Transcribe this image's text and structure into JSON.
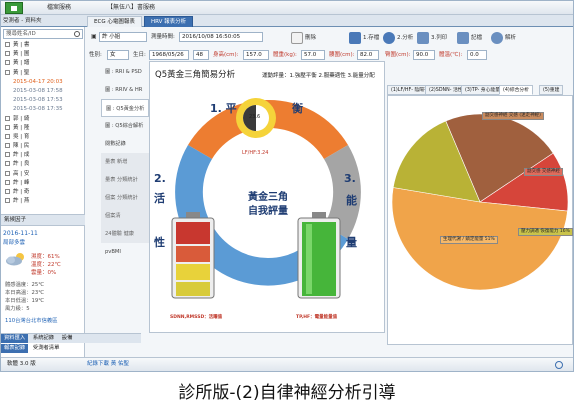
{
  "topbar": {
    "buttons": [
      "檔案服務",
      "【無伍八】書服務"
    ]
  },
  "tabs": [
    "ECG 心電圖報表",
    "HRV 報表分析"
  ],
  "left": {
    "search_placeholder": "搜尋姓名/ID",
    "title": "受測者 - 資料夾",
    "patients": [
      {
        "label": "黃 | 書",
        "type": "row"
      },
      {
        "label": "黃 | 圖",
        "type": "row"
      },
      {
        "label": "黃 | 譜",
        "type": "row"
      },
      {
        "label": "黃 | 聖",
        "type": "row"
      },
      {
        "label": "2015-04-17 20:03",
        "type": "date",
        "selected": true
      },
      {
        "label": "2015-03-08 17:58",
        "type": "date"
      },
      {
        "label": "2015-03-08 17:53",
        "type": "date"
      },
      {
        "label": "2015-03-08 17:35",
        "type": "date"
      },
      {
        "label": "郭 | 綺",
        "type": "row"
      },
      {
        "label": "黃 | 隆",
        "type": "row"
      },
      {
        "label": "吳 | 育",
        "type": "row"
      },
      {
        "label": "陳 | 民",
        "type": "row"
      },
      {
        "label": "許 | 成",
        "type": "row"
      },
      {
        "label": "許 | 良",
        "type": "row"
      },
      {
        "label": "高 | 安",
        "type": "row"
      },
      {
        "label": "許 | 峰",
        "type": "row"
      },
      {
        "label": "許 | 奇",
        "type": "row"
      },
      {
        "label": "許 | 燕",
        "type": "row"
      }
    ],
    "mini_panel_title": "氣候因子",
    "weather": {
      "date": "2016-11-11",
      "city": "局部多雲",
      "humidity_label": "濕度：",
      "humidity": "61%",
      "temp_label": "溫度：",
      "temp": "22℃",
      "cloud_label": "雲量：",
      "cloud": "0%",
      "lines": [
        "體感溫度：25℃",
        "本日高溫：23℃",
        "本日低溫：19℃",
        "     風力級：5"
      ],
      "location": "110台灣台北市信義區"
    },
    "bottom_tabs": [
      "資料匯入",
      "系統記錄",
      "設備"
    ],
    "bottom_tabs2": [
      "報表記錄",
      "受測者清單"
    ]
  },
  "status": {
    "left": "軟體 3.0 版",
    "middle": "紀錄下載  黃 佑聖"
  },
  "toolbar": {
    "name_value": "許 小姐",
    "measure_label": "測量時間:",
    "measure_value": "2016/10/08 16:50:05",
    "delete_label": "刪除",
    "save_label": "1.存檔",
    "analyze_label": "2.分析",
    "print_label": "3.列印",
    "record_label": "記檔",
    "help_label": "解析"
  },
  "infobar": {
    "sex_label": "性別:",
    "sex": "女",
    "birth_label": "生日:",
    "birth": "1968/05/26",
    "age": "48",
    "height_label": "身高(cm):",
    "height": "157.0",
    "weight_label": "體重(kg):",
    "weight": "57.0",
    "waist_label": "腰圍(cm):",
    "waist": "82.0",
    "hip_label": "臀圍(cm):",
    "hip": "90.0",
    "temp_label": "體溫(℃):",
    "temp": "0.0"
  },
  "menu": [
    "圖 : RRI & PSD",
    "圖 : RRIV & HR",
    "圖 : Q5黃金分析",
    "圖 : Q5綜合解析",
    "閱數記錄",
    "量表 新增",
    "量表 分類統計",
    "個案 分類統計",
    "個案清",
    "24體驗 健康",
    "pvBMI"
  ],
  "center": {
    "title": "Q5黃金三角簡易分析",
    "subtitle": "運動評量：1.強壓平衡 2.服藥適性 3.能量分配",
    "labels": {
      "one": "1. 平",
      "heng": "衡",
      "two": "2.",
      "huo": "活",
      "xing": "性",
      "three": "3.",
      "neng": "能",
      "liang": "量"
    },
    "golden_line1": "黃金三角",
    "golden_line2": "自我評量",
    "gauge_value": "23.6",
    "gauge_sub": "LF/HF:3.24",
    "left_battery_label": "SDNN,RMSSD：活躍值",
    "right_battery_label": "TP,HF：電量能量值"
  },
  "right": {
    "tabs": [
      "(1)LF/HF- 陰陽平衡",
      "(2)SDNN- 活性",
      "(3)TP- 身心能量",
      "(4)綜合分析",
      "(5)重建"
    ],
    "active_tab": 3,
    "pie_labels": [
      "副交感神經 交感 (迷走神經)",
      "副交感 交感神經",
      "生理代謝 / 鎮定能量 51%",
      "壓力調適 恢復能力 16%"
    ]
  },
  "chart_data": {
    "type": "pie",
    "categories": [
      "副交感",
      "交感神經",
      "生理代謝 鎮定能量",
      "壓力調適 恢復能力"
    ],
    "values": [
      22,
      11,
      51,
      16
    ],
    "colors": [
      "#a0603e",
      "#d6453a",
      "#f0a44a",
      "#b9b236"
    ]
  },
  "caption": "診所版-(2)自律神經分析引導"
}
